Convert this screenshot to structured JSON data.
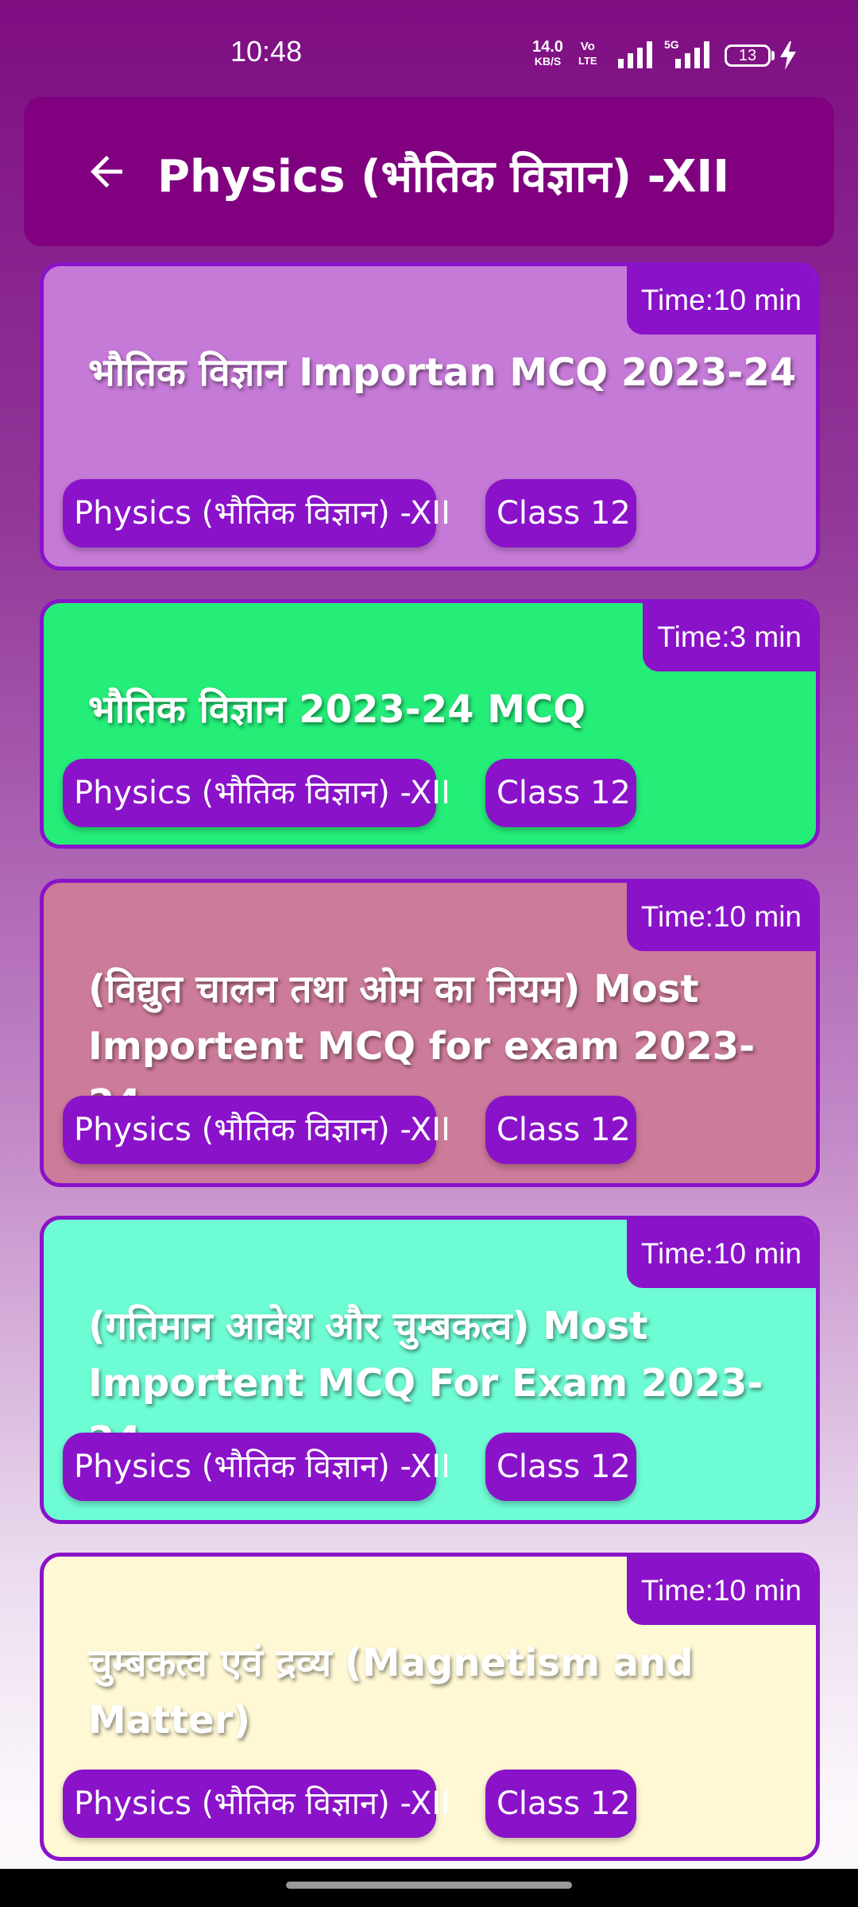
{
  "status": {
    "time": "10:48",
    "net_speed_value": "14.0",
    "net_speed_unit": "KB/S",
    "volte_top": "Vo",
    "volte_bottom": "LTE",
    "net_type": "5G",
    "battery": "13"
  },
  "header": {
    "title": "Physics (भौतिक विज्ञान) -XII",
    "back_icon": "arrow-left-icon"
  },
  "colors": {
    "app_bar": "#800080",
    "accent": "#8a12c9",
    "card_1": "#c67ad7",
    "card_2": "#24ed78",
    "card_3": "#cd7b9a",
    "card_4": "#6efcd5",
    "card_5": "#fff8d4"
  },
  "quizzes": [
    {
      "time": "Time:10 min",
      "title": "भौतिक विज्ञान Importan MCQ 2023-24",
      "subject": "Physics (भौतिक विज्ञान) -XII",
      "class": "Class 12"
    },
    {
      "time": "Time:3 min",
      "title": "भौतिक विज्ञान 2023-24 MCQ",
      "subject": "Physics (भौतिक विज्ञान) -XII",
      "class": "Class 12"
    },
    {
      "time": "Time:10 min",
      "title": "(विद्युत चालन तथा ओम का नियम) Most Importent MCQ for exam 2023-24",
      "subject": "Physics (भौतिक विज्ञान) -XII",
      "class": "Class 12"
    },
    {
      "time": "Time:10 min",
      "title": "(गतिमान आवेश और चुम्बकत्व)  Most Importent MCQ For Exam 2023-24",
      "subject": "Physics (भौतिक विज्ञान) -XII",
      "class": "Class 12"
    },
    {
      "time": "Time:10 min",
      "title": "चुम्बकत्व एवं द्रव्य (Magnetism and Matter)",
      "subject": "Physics (भौतिक विज्ञान) -XII",
      "class": "Class 12"
    }
  ]
}
